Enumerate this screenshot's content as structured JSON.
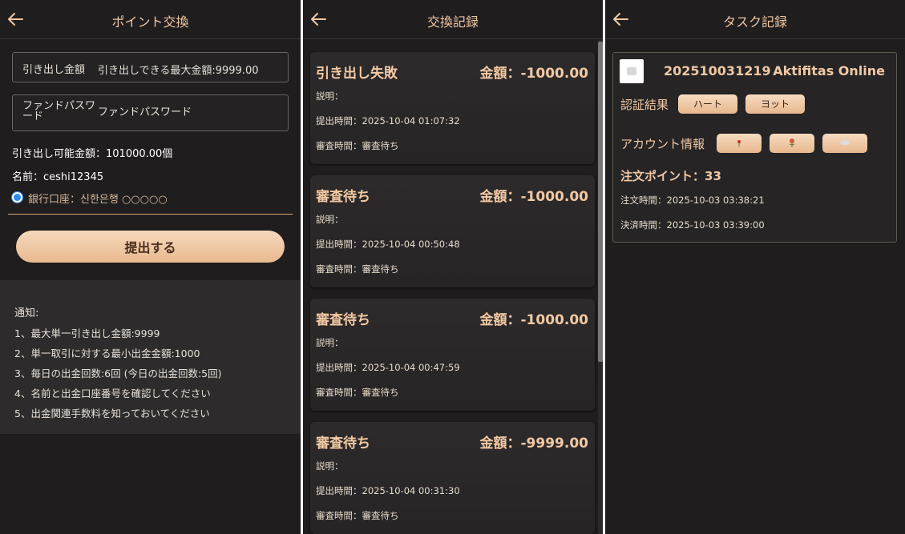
{
  "exchange": {
    "title": "ポイント交換",
    "fields": [
      {
        "label": "引き出し金額",
        "placeholder": "引き出しできる最大金額:9999.00"
      },
      {
        "label": "ファンドパスワード",
        "placeholder": "ファンドパスワード"
      }
    ],
    "available": "引き出し可能金額：101000.00個",
    "name": "名前：ceshi12345",
    "bank": "銀行口座：신한은행 ○○○○○",
    "submit_label": "提出する",
    "notice_title": "通知:",
    "notices": [
      "1、最大単一引き出し金額:9999",
      "2、単一取引に対する最小出金金額:1000",
      "3、毎日の出金回数:6回 (今日の出金回数:5回)",
      "4、名前と出金口座番号を確認してください",
      "5、出金関連手数料を知っておいてください"
    ]
  },
  "records": {
    "title": "交換記録",
    "items": [
      {
        "status": "引き出し失敗",
        "amount": "金額：-1000.00",
        "desc": "説明：",
        "submitted": "提出時間：2025-10-04 01:07:32",
        "reviewed": "審査時間：審査待ち"
      },
      {
        "status": "審査待ち",
        "amount": "金額：-1000.00",
        "desc": "説明：",
        "submitted": "提出時間：2025-10-04 00:50:48",
        "reviewed": "審査時間：審査待ち"
      },
      {
        "status": "審査待ち",
        "amount": "金額：-1000.00",
        "desc": "説明：",
        "submitted": "提出時間：2025-10-04 00:47:59",
        "reviewed": "審査時間：審査待ち"
      },
      {
        "status": "審査待ち",
        "amount": "金額：-9999.00",
        "desc": "説明：",
        "submitted": "提出時間：2025-10-04 00:31:30",
        "reviewed": "審査時間：審査待ち"
      }
    ]
  },
  "tasks": {
    "title": "タスク記録",
    "order_no": "202510031219",
    "shop": "Aktifitas Online",
    "auth_label": "認証結果",
    "auth_buttons": [
      "ハート",
      "ヨット"
    ],
    "account_label": "アカウント情報",
    "points": "注文ポイント：33",
    "order_time": "注文時間：2025-10-03 03:38:21",
    "payment_time": "決済時間：2025-10-03 03:39:00"
  },
  "colors": {
    "accent": "#f0c8a4",
    "background": "#1f1d1e",
    "button": "#e8b98f",
    "radio": "#2d8cf0"
  }
}
